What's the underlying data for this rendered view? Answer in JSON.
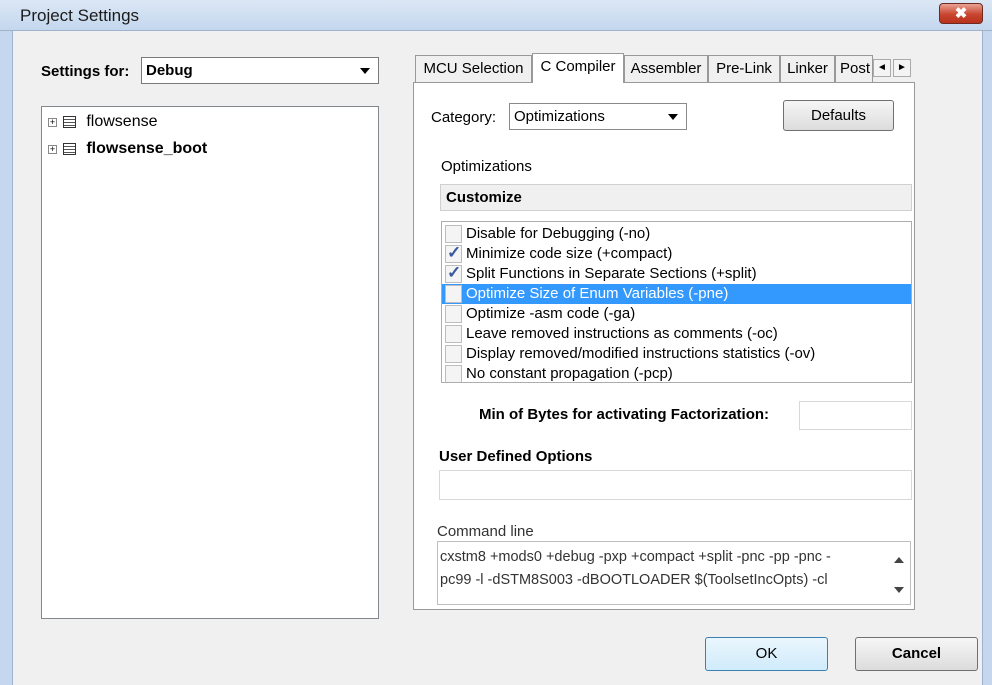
{
  "window": {
    "title": "Project Settings",
    "close_glyph": "✖"
  },
  "settings_for": {
    "label": "Settings for:",
    "value": "Debug"
  },
  "tree": {
    "items": [
      {
        "label": "flowsense",
        "bold": false,
        "expander": "+"
      },
      {
        "label": "flowsense_boot",
        "bold": true,
        "expander": "+"
      }
    ]
  },
  "tabs": [
    {
      "label": "MCU Selection"
    },
    {
      "label": "C Compiler"
    },
    {
      "label": "Assembler"
    },
    {
      "label": "Pre-Link"
    },
    {
      "label": "Linker"
    },
    {
      "label": "Post"
    }
  ],
  "active_tab": "C Compiler",
  "tab_scroll": {
    "left": "◄",
    "right": "►"
  },
  "category": {
    "label": "Category:",
    "value": "Optimizations"
  },
  "defaults_button": "Defaults",
  "optimizations": {
    "heading": "Optimizations",
    "mode": "Customize",
    "options": [
      {
        "label": "Disable for Debugging (-no)",
        "checked": false,
        "selected": false
      },
      {
        "label": "Minimize code size (+compact)",
        "checked": true,
        "selected": false
      },
      {
        "label": "Split Functions in Separate Sections (+split)",
        "checked": true,
        "selected": false
      },
      {
        "label": "Optimize Size of Enum Variables (-pne)",
        "checked": false,
        "selected": true
      },
      {
        "label": "Optimize -asm code (-ga)",
        "checked": false,
        "selected": false
      },
      {
        "label": "Leave removed instructions as comments (-oc)",
        "checked": false,
        "selected": false
      },
      {
        "label": "Display removed/modified instructions statistics (-ov)",
        "checked": false,
        "selected": false
      },
      {
        "label": "No constant propagation (-pcp)",
        "checked": false,
        "selected": false
      }
    ],
    "check_glyph": "✓"
  },
  "factorization": {
    "label": "Min of Bytes for activating Factorization:",
    "value": ""
  },
  "user_defined": {
    "label": "User Defined Options",
    "value": ""
  },
  "command_line": {
    "label": "Command line",
    "lines": [
      "cxstm8 +mods0 +debug -pxp +compact +split -pnc -pp -pnc -",
      "pc99 -l -dSTM8S003 -dBOOTLOADER $(ToolsetIncOpts) -cl"
    ]
  },
  "buttons": {
    "ok": "OK",
    "cancel": "Cancel"
  }
}
